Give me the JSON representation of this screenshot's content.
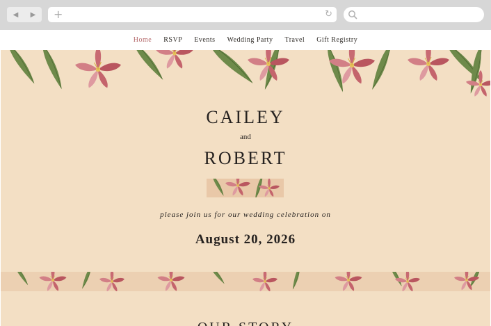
{
  "browser": {
    "back_icon": "back-arrow-icon",
    "forward_icon": "forward-arrow-icon",
    "new_tab_icon": "plus-icon",
    "reload_icon": "reload-icon",
    "search_icon": "search-icon"
  },
  "nav": {
    "items": [
      {
        "label": "Home",
        "active": true
      },
      {
        "label": "RSVP",
        "active": false
      },
      {
        "label": "Events",
        "active": false
      },
      {
        "label": "Wedding Party",
        "active": false
      },
      {
        "label": "Travel",
        "active": false
      },
      {
        "label": "Gift Registry",
        "active": false
      }
    ]
  },
  "hero": {
    "name1": "CAILEY",
    "and": "and",
    "name2": "ROBERT",
    "invite": "please join us for our wedding celebration on",
    "date": "August 20, 2026"
  },
  "section": {
    "title": "OUR STORY"
  },
  "colors": {
    "background": "#f3dfc4",
    "accent": "#b4686a",
    "text": "#262220",
    "flower": "#c86a72",
    "leaf": "#6e8a4a"
  }
}
